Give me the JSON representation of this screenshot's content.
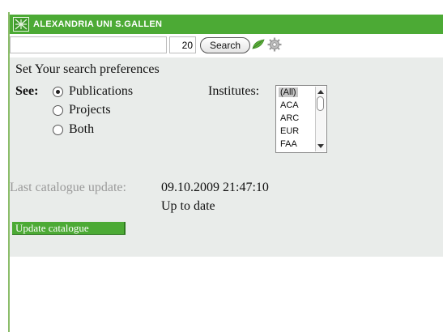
{
  "header": {
    "title": "ALEXANDRIA UNI S.GALLEN",
    "logo_icon": "alexandria-logo-icon"
  },
  "search": {
    "query_value": "",
    "count_value": "20",
    "button_label": "Search",
    "icons": [
      "leaf-icon",
      "gear-icon"
    ]
  },
  "preferences": {
    "heading": "Set Your search preferences",
    "see_label": "See:",
    "options": [
      {
        "label": "Publications",
        "checked": true
      },
      {
        "label": "Projects",
        "checked": false
      },
      {
        "label": "Both",
        "checked": false
      }
    ],
    "institutes_label": "Institutes:",
    "institutes": [
      "(All)",
      "ACA",
      "ARC",
      "EUR",
      "FAA"
    ],
    "institutes_selected": "(All)"
  },
  "catalogue": {
    "label": "Last catalogue update:",
    "date": "09.10.2009 21:47:10",
    "status": "Up to date",
    "button_label": "Update catalogue"
  },
  "colors": {
    "brand_green": "#4caa35",
    "panel_bg": "#e9ecea"
  }
}
